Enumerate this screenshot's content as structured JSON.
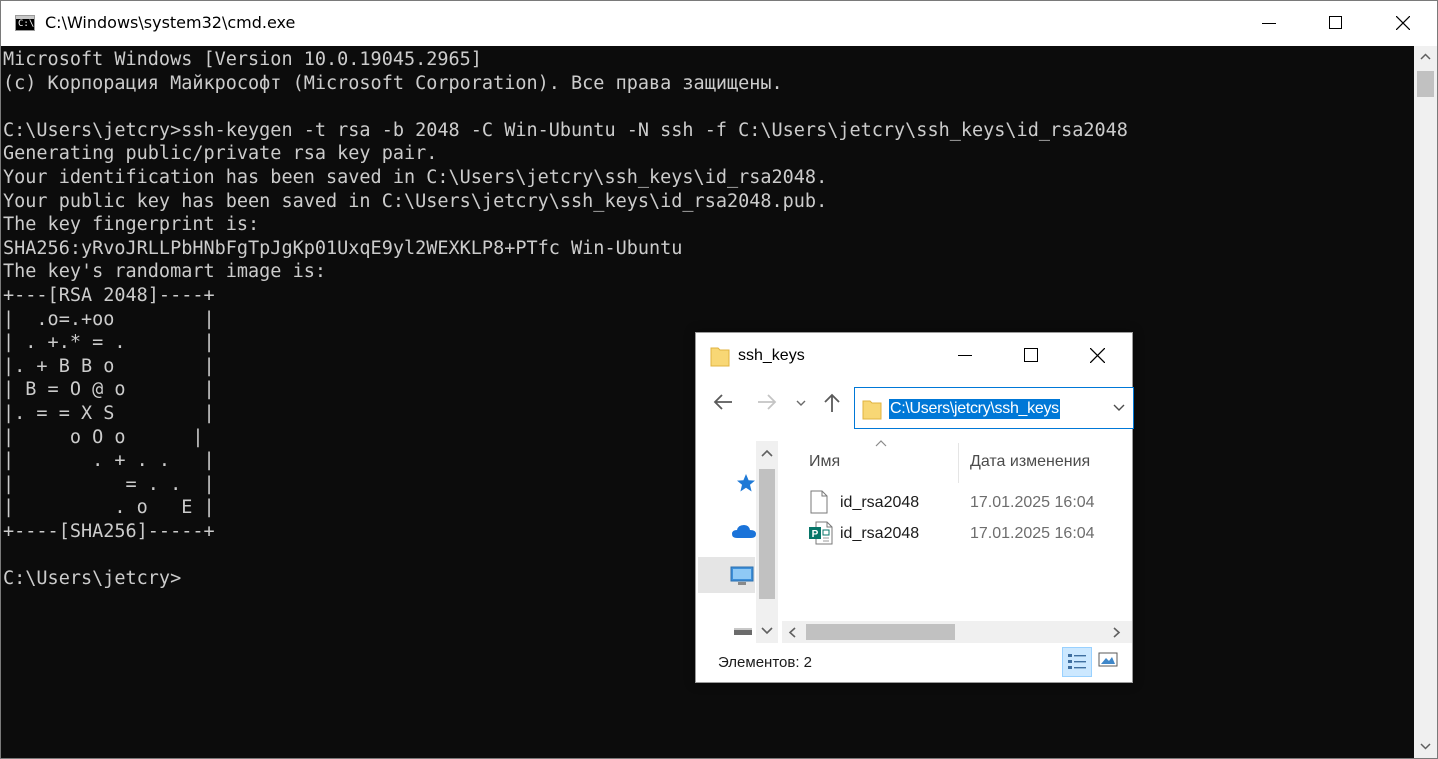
{
  "cmd": {
    "title": "C:\\Windows\\system32\\cmd.exe",
    "icon_prompt": "C:\\",
    "lines": [
      "Microsoft Windows [Version 10.0.19045.2965]",
      "(c) Корпорация Майкрософт (Microsoft Corporation). Все права защищены.",
      "",
      "C:\\Users\\jetcry>ssh-keygen -t rsa -b 2048 -C Win-Ubuntu -N ssh -f C:\\Users\\jetcry\\ssh_keys\\id_rsa2048",
      "Generating public/private rsa key pair.",
      "Your identification has been saved in C:\\Users\\jetcry\\ssh_keys\\id_rsa2048.",
      "Your public key has been saved in C:\\Users\\jetcry\\ssh_keys\\id_rsa2048.pub.",
      "The key fingerprint is:",
      "SHA256:yRvoJRLLPbHNbFgTpJgKp01UxqE9yl2WEXKLP8+PTfc Win-Ubuntu",
      "The key's randomart image is:",
      "+---[RSA 2048]----+",
      "|  .o=.+oo        |",
      "| . +.* = .       |",
      "|. + B B o        |",
      "| B = O @ o       |",
      "|. = = X S        |",
      "|     o O o      |",
      "|       . + . .   |",
      "|          = . .  |",
      "|         . o   E |",
      "+----[SHA256]-----+",
      "",
      "C:\\Users\\jetcry>"
    ]
  },
  "explorer": {
    "title": "ssh_keys",
    "address": "C:\\Users\\jetcry\\ssh_keys",
    "columns": {
      "name": "Имя",
      "date": "Дата изменения"
    },
    "files": [
      {
        "name": "id_rsa2048",
        "date": "17.01.2025 16:04",
        "icon": "file-icon"
      },
      {
        "name": "id_rsa2048",
        "date": "17.01.2025 16:04",
        "icon": "publisher-file-icon"
      }
    ],
    "status": "Элементов: 2",
    "colors": {
      "accent": "#0078d7",
      "selected_view": "#cce8ff"
    }
  }
}
